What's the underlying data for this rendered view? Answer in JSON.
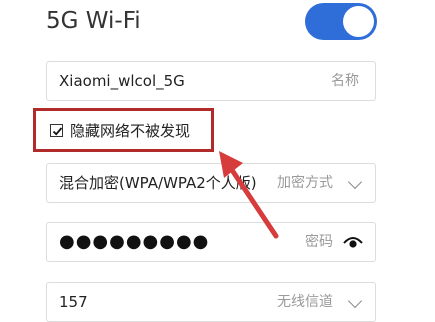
{
  "wifi_title": "5G Wi-Fi",
  "wifi_enabled": true,
  "ssid": {
    "value": "Xiaomi_wlcol_5G",
    "label": "名称"
  },
  "hide_network": {
    "checked": true,
    "label": "隐藏网络不被发现"
  },
  "encryption": {
    "value": "混合加密(WPA/WPA2个人版)",
    "label": "加密方式"
  },
  "password": {
    "masked_value": "●●●●●●●●●",
    "label": "密码"
  },
  "channel": {
    "value": "157",
    "label": "无线信道"
  },
  "colors": {
    "toggle": "#2f6ed8",
    "highlight": "#b22b2b",
    "arrow": "#d63c3c"
  },
  "icons": [
    "chevron-down-icon",
    "eye-icon",
    "checkmark-icon"
  ]
}
